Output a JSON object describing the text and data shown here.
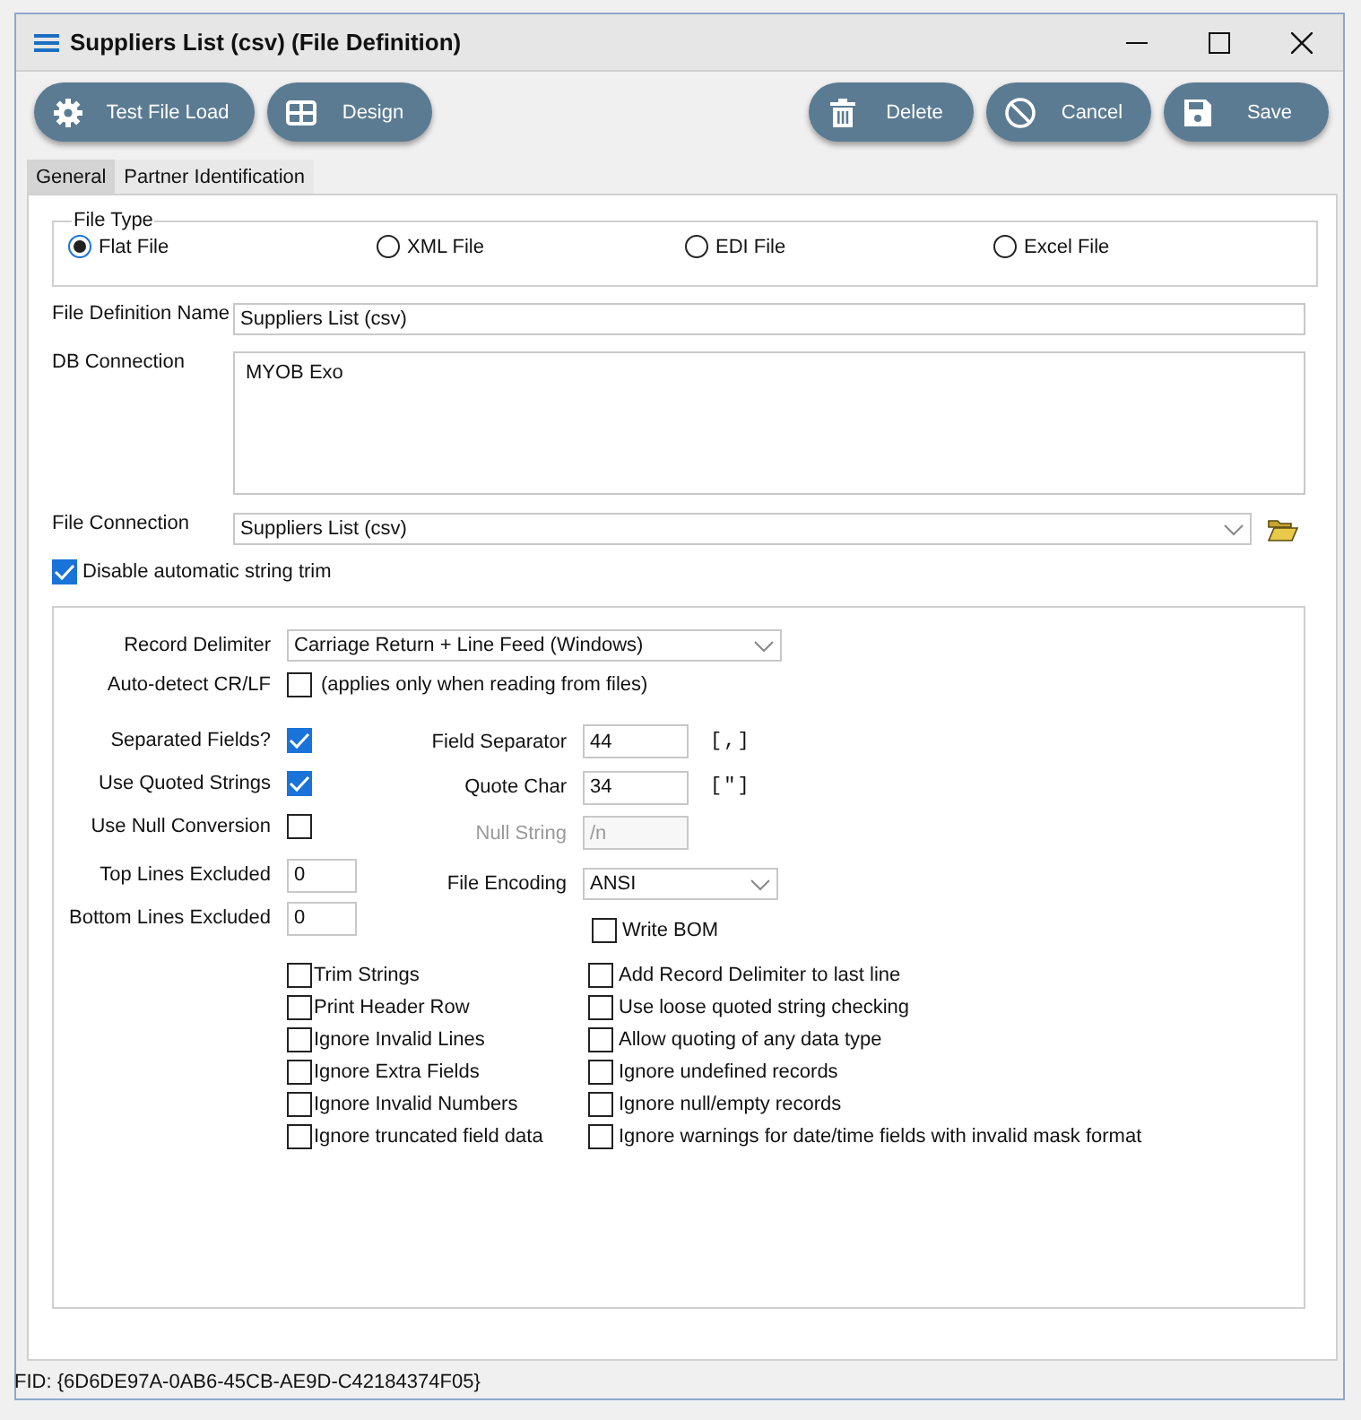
{
  "window": {
    "title": "Suppliers List (csv) (File Definition)"
  },
  "toolbar": {
    "left": [
      {
        "label": "Test File Load"
      },
      {
        "label": "Design"
      }
    ],
    "right": [
      {
        "label": "Delete"
      },
      {
        "label": "Cancel"
      },
      {
        "label": "Save"
      }
    ]
  },
  "tabs": [
    {
      "label": "General",
      "selected": true
    },
    {
      "label": "Partner Identification",
      "selected": false
    }
  ],
  "file_type": {
    "legend": "File Type",
    "options": [
      {
        "label": "Flat File",
        "selected": true
      },
      {
        "label": "XML File",
        "selected": false
      },
      {
        "label": "EDI File",
        "selected": false
      },
      {
        "label": "Excel File",
        "selected": false
      }
    ]
  },
  "file_definition_name": {
    "label": "File Definition Name",
    "value": "Suppliers List (csv)"
  },
  "db_connection": {
    "label": "DB Connection",
    "value": "MYOB Exo"
  },
  "file_connection": {
    "label": "File Connection",
    "value": "Suppliers List (csv)"
  },
  "disable_trim": {
    "label": "Disable automatic string trim",
    "checked": true
  },
  "record_delimiter": {
    "label": "Record Delimiter",
    "value": "Carriage Return + Line Feed (Windows)"
  },
  "auto_detect": {
    "label": "Auto-detect CR/LF",
    "checked": false,
    "note": "(applies only when reading from files)"
  },
  "left_fields": [
    {
      "kind": "checkbox",
      "label": "Separated Fields?",
      "checked": true
    },
    {
      "kind": "checkbox",
      "label": "Use Quoted Strings",
      "checked": true
    },
    {
      "kind": "checkbox",
      "label": "Use Null Conversion",
      "checked": false
    },
    {
      "kind": "input",
      "label": "Top Lines Excluded",
      "value": "0"
    },
    {
      "kind": "input",
      "label": "Bottom Lines Excluded",
      "value": "0"
    }
  ],
  "right_fields": [
    {
      "kind": "input",
      "label": "Field Separator",
      "value": "44",
      "hint": "[,]",
      "disabled": false
    },
    {
      "kind": "input",
      "label": "Quote Char",
      "value": "34",
      "hint": "[\"]",
      "disabled": false
    },
    {
      "kind": "input",
      "label": "Null String",
      "value": "/n",
      "disabled": true
    },
    {
      "kind": "select",
      "label": "File Encoding",
      "value": "ANSI",
      "disabled": false
    },
    {
      "kind": "checkbox",
      "label": "Write BOM",
      "checked": false,
      "disabled": false
    }
  ],
  "options_left": [
    {
      "label": "Trim Strings",
      "checked": false
    },
    {
      "label": "Print Header Row",
      "checked": false
    },
    {
      "label": "Ignore Invalid Lines",
      "checked": false
    },
    {
      "label": "Ignore Extra Fields",
      "checked": false
    },
    {
      "label": "Ignore Invalid Numbers",
      "checked": false
    },
    {
      "label": "Ignore truncated field data",
      "checked": false
    }
  ],
  "options_right": [
    {
      "label": "Add Record Delimiter to last line",
      "checked": false
    },
    {
      "label": "Use loose quoted string checking",
      "checked": false
    },
    {
      "label": "Allow quoting of any data type",
      "checked": false
    },
    {
      "label": "Ignore undefined records",
      "checked": false
    },
    {
      "label": "Ignore null/empty records",
      "checked": false
    },
    {
      "label": "Ignore warnings for date/time fields with invalid mask format",
      "checked": false
    }
  ],
  "status_bar": "FID: {6D6DE97A-0AB6-45CB-AE9D-C42184374F05}"
}
